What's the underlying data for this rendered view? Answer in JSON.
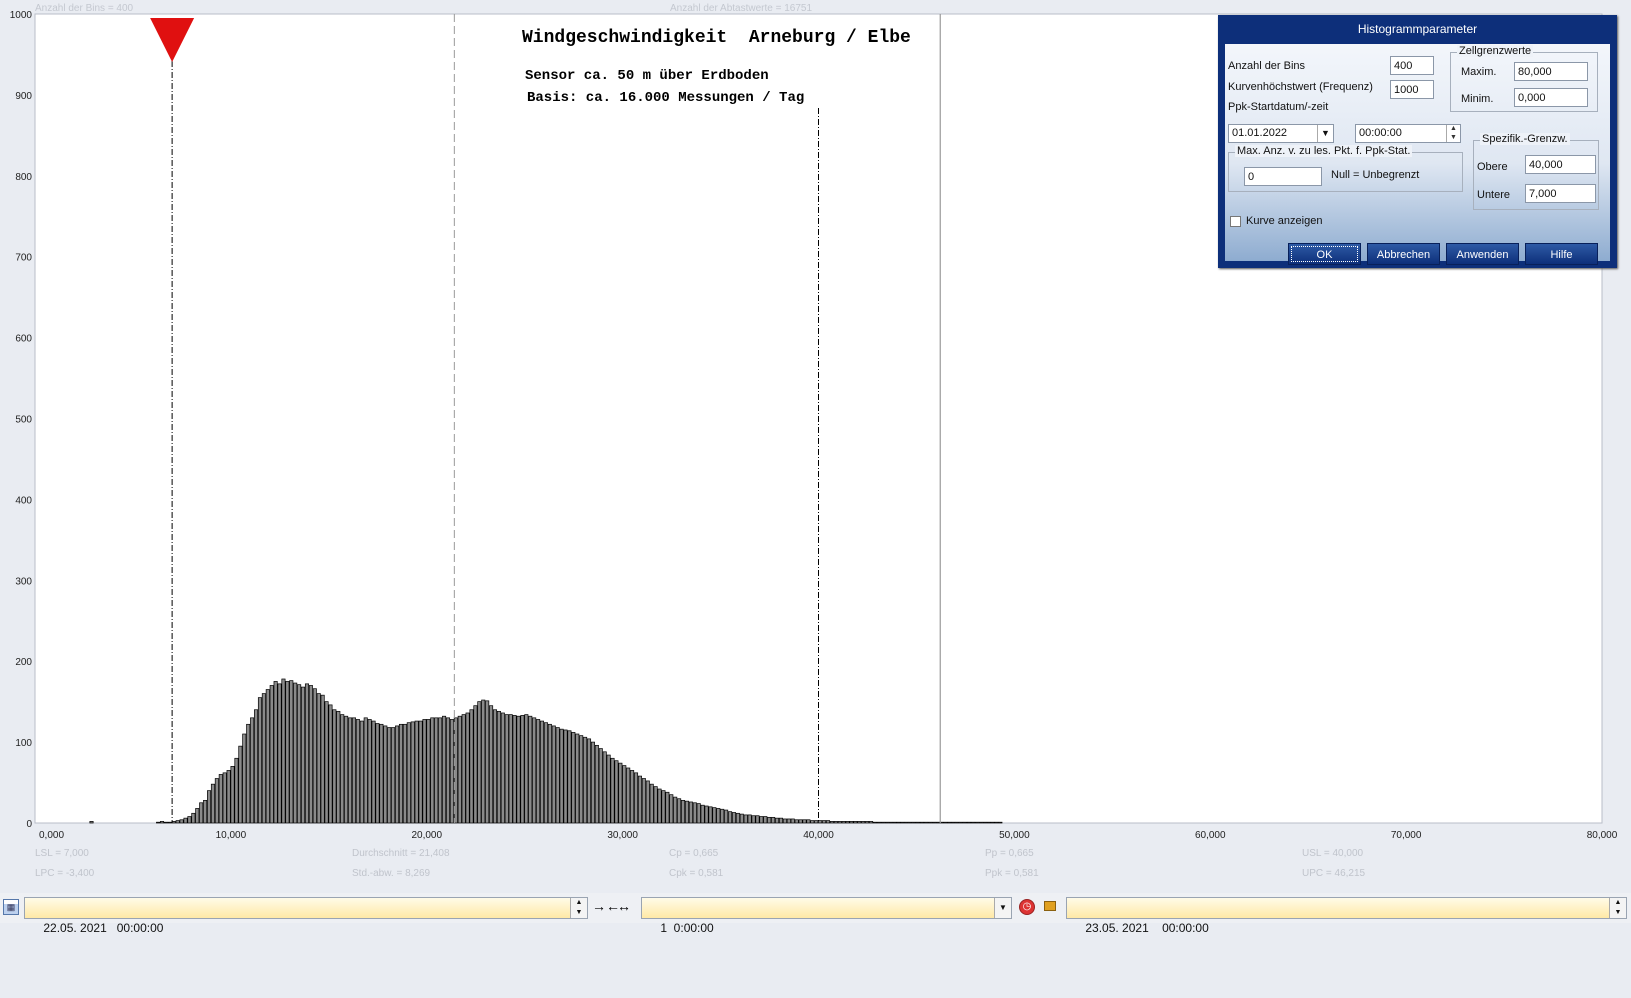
{
  "header": {
    "bins_label": "Anzahl der Bins =   400",
    "samples_label": "Anzahl der Abtastwerte = 16751"
  },
  "chart_data": {
    "type": "bar",
    "title": "Windgeschwindigkeit  Arneburg / Elbe",
    "subtitle_lines": [
      "Sensor ca. 50 m über Erdboden",
      "Basis: ca. 16.000 Messungen / Tag"
    ],
    "xlim": [
      0,
      80
    ],
    "ylim": [
      0,
      1000
    ],
    "x_ticks": [
      "0,000",
      "10,000",
      "20,000",
      "30,000",
      "40,000",
      "50,000",
      "60,000",
      "70,000",
      "80,000"
    ],
    "y_ticks": [
      "0",
      "100",
      "200",
      "300",
      "400",
      "500",
      "600",
      "700",
      "800",
      "900",
      "1000"
    ],
    "bin_width": 0.2,
    "bin_start": 0,
    "values": [
      0,
      0,
      0,
      0,
      0,
      0,
      0,
      0,
      0,
      0,
      0,
      0,
      0,
      0,
      2,
      0,
      0,
      0,
      0,
      0,
      0,
      0,
      0,
      0,
      0,
      0,
      0,
      0,
      0,
      0,
      0,
      1,
      2,
      1,
      1,
      2,
      3,
      4,
      6,
      8,
      12,
      18,
      25,
      28,
      40,
      48,
      55,
      60,
      62,
      65,
      70,
      80,
      95,
      110,
      122,
      130,
      140,
      155,
      160,
      165,
      170,
      175,
      172,
      178,
      175,
      176,
      173,
      171,
      168,
      172,
      170,
      166,
      160,
      158,
      150,
      146,
      140,
      138,
      134,
      132,
      130,
      130,
      128,
      126,
      130,
      128,
      126,
      123,
      122,
      120,
      118,
      118,
      120,
      122,
      122,
      124,
      125,
      126,
      126,
      128,
      128,
      130,
      130,
      130,
      132,
      130,
      128,
      130,
      132,
      134,
      136,
      140,
      145,
      150,
      152,
      151,
      145,
      140,
      138,
      136,
      134,
      134,
      133,
      132,
      133,
      134,
      132,
      130,
      128,
      126,
      124,
      122,
      120,
      118,
      116,
      115,
      114,
      112,
      110,
      108,
      106,
      104,
      100,
      96,
      92,
      88,
      84,
      80,
      77,
      74,
      71,
      68,
      65,
      62,
      58,
      55,
      52,
      48,
      45,
      42,
      40,
      38,
      35,
      32,
      30,
      28,
      27,
      26,
      25,
      24,
      22,
      21,
      20,
      19,
      18,
      17,
      16,
      14,
      13,
      12,
      11,
      10,
      10,
      9,
      9,
      8,
      8,
      7,
      7,
      6,
      6,
      5,
      5,
      5,
      4,
      4,
      4,
      4,
      3,
      3,
      3,
      3,
      3,
      2,
      2,
      2,
      2,
      2,
      2,
      2,
      2,
      2,
      2,
      2,
      1,
      1,
      1,
      1,
      1,
      1,
      1,
      1,
      1,
      1,
      1,
      1,
      1,
      1,
      1,
      1,
      1,
      1,
      1,
      1,
      1,
      1,
      1,
      1,
      1,
      1,
      1,
      1,
      1,
      1,
      1,
      1,
      1
    ],
    "lsl": 7.0,
    "usl": 40.0,
    "lpc": -3.4,
    "upc": 46.215,
    "mean": 21.408,
    "stats": {
      "lsl": "LSL = 7,000",
      "lpc": "LPC = -3,400",
      "mean": "Durchschnitt  = 21,408",
      "std": "Std.-abw. = 8,269",
      "cp": "Cp  = 0,665",
      "cpk": "Cpk = 0,581",
      "pp": "Pp  = 0,665",
      "ppk": "Ppk = 0,581",
      "usl": "USL = 40,000",
      "upc": "UPC = 46,215"
    },
    "bar_fill": "#8a8a8a",
    "bar_stroke": "#000000",
    "marker_color": "#e01010"
  },
  "dialog": {
    "title": "Histogrammparameter",
    "bins_label": "Anzahl der Bins",
    "bins_value": "400",
    "curve_max_label": "Kurvenhöchstwert (Frequenz)",
    "curve_max_value": "1000",
    "ppk_label": "Ppk-Startdatum/-zeit",
    "ppk_date": "01.01.2022",
    "ppk_time": "00:00:00",
    "maxpkt_group": "Max. Anz. v. zu les. Pkt. f. Ppk-Stat.",
    "maxpkt_value": "0",
    "null_label": "Null = Unbegrenzt",
    "curve_checkbox": "Kurve anzeigen",
    "cell_group": "Zellgrenzwerte",
    "max_label": "Maxim.",
    "max_value": "80,000",
    "min_label": "Minim.",
    "min_value": "0,000",
    "spec_group": "Spezifik.-Grenzw.",
    "upper_label": "Obere",
    "upper_value": "40,000",
    "lower_label": "Untere",
    "lower_value": "7,000",
    "ok": "OK",
    "cancel": "Abbrechen",
    "apply": "Anwenden",
    "help": "Hilfe"
  },
  "bottom_bar": {
    "start": "22.05. 2021   00:00:00",
    "interval": "1  0:00:00",
    "end": "23.05. 2021    00:00:00"
  }
}
